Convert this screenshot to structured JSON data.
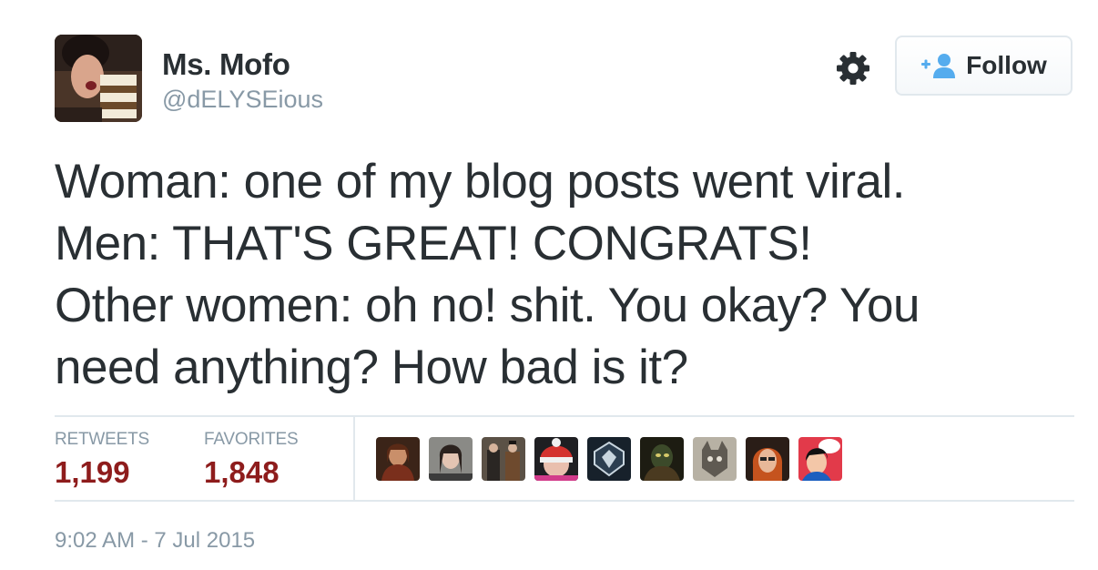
{
  "author": {
    "name": "Ms. Mofo",
    "handle": "@dELYSEious"
  },
  "actions": {
    "follow_label": "Follow"
  },
  "tweet": {
    "lines": [
      "Woman: one of my blog posts went viral.",
      "Men: THAT'S GREAT! CONGRATS!",
      "Other women: oh no! shit. You okay? You",
      "need anything? How bad is it?"
    ]
  },
  "stats": {
    "retweets_label": "RETWEETS",
    "retweets_count": "1,199",
    "favorites_label": "FAVORITES",
    "favorites_count": "1,848"
  },
  "timestamp": "9:02 AM - 7 Jul 2015",
  "colors": {
    "text": "#292f33",
    "muted": "#8899a6",
    "count": "#8e1c1c",
    "follow_icon": "#55acee",
    "border": "#e1e8ed"
  },
  "icons": {
    "settings": "gear-icon",
    "follow": "add-person-icon"
  }
}
